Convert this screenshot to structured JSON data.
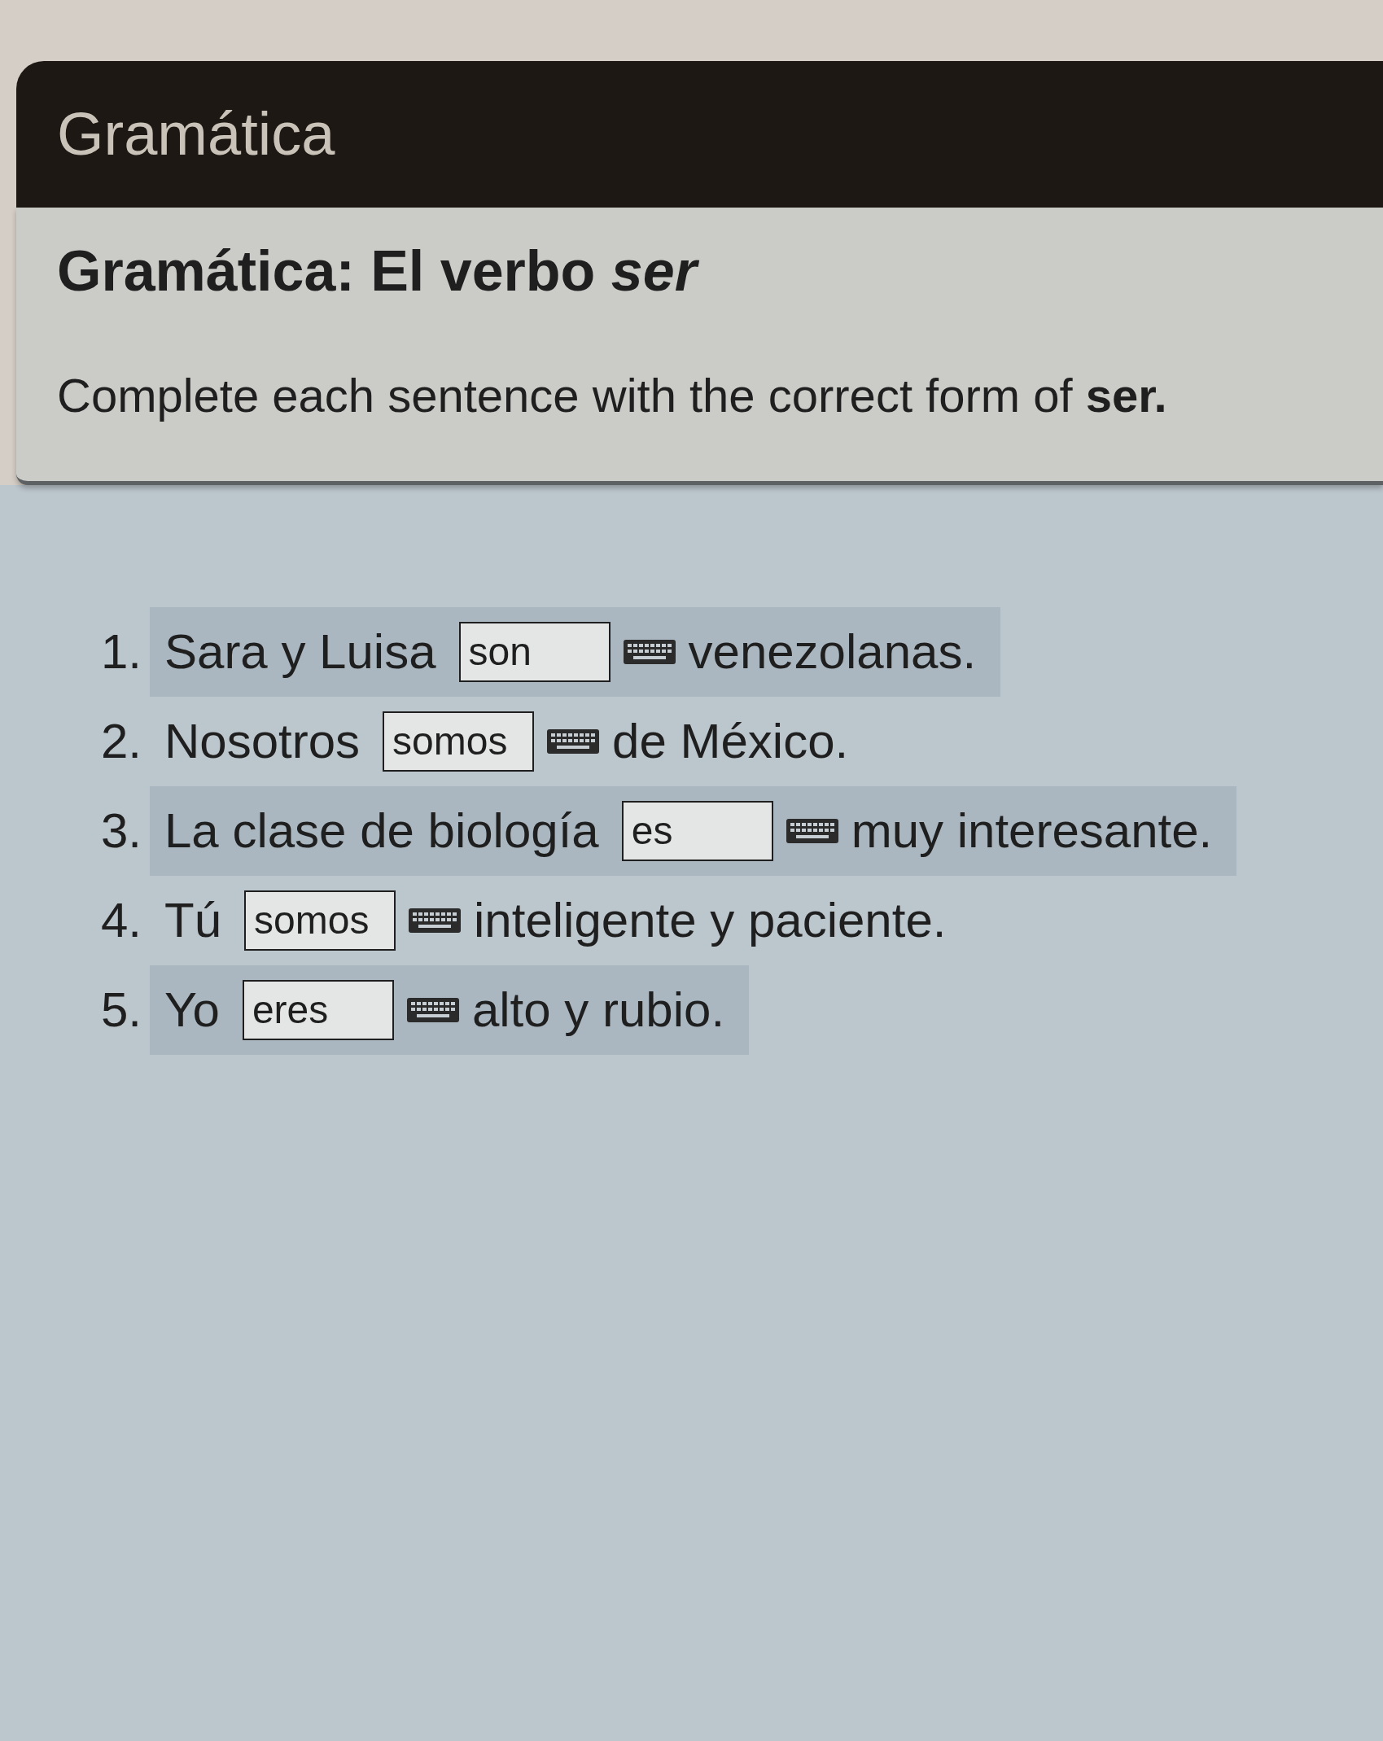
{
  "header": {
    "title": "Gramática"
  },
  "activity": {
    "title": "Gramática: El verbo *ser*",
    "instruction": "Complete each sentence with the correct form of **ser.**"
  },
  "items": [
    {
      "number": "1.",
      "before": "Sara y Luisa",
      "answer": "son",
      "after": "venezolanas."
    },
    {
      "number": "2.",
      "before": "Nosotros",
      "answer": "somos",
      "after": "de México."
    },
    {
      "number": "3.",
      "before": "La clase de biología",
      "answer": "es",
      "after": "muy interesante."
    },
    {
      "number": "4.",
      "before": "Tú",
      "answer": "somos",
      "after": "inteligente y paciente."
    },
    {
      "number": "5.",
      "before": "Yo",
      "answer": "eres",
      "after": "alto y rubio."
    }
  ]
}
